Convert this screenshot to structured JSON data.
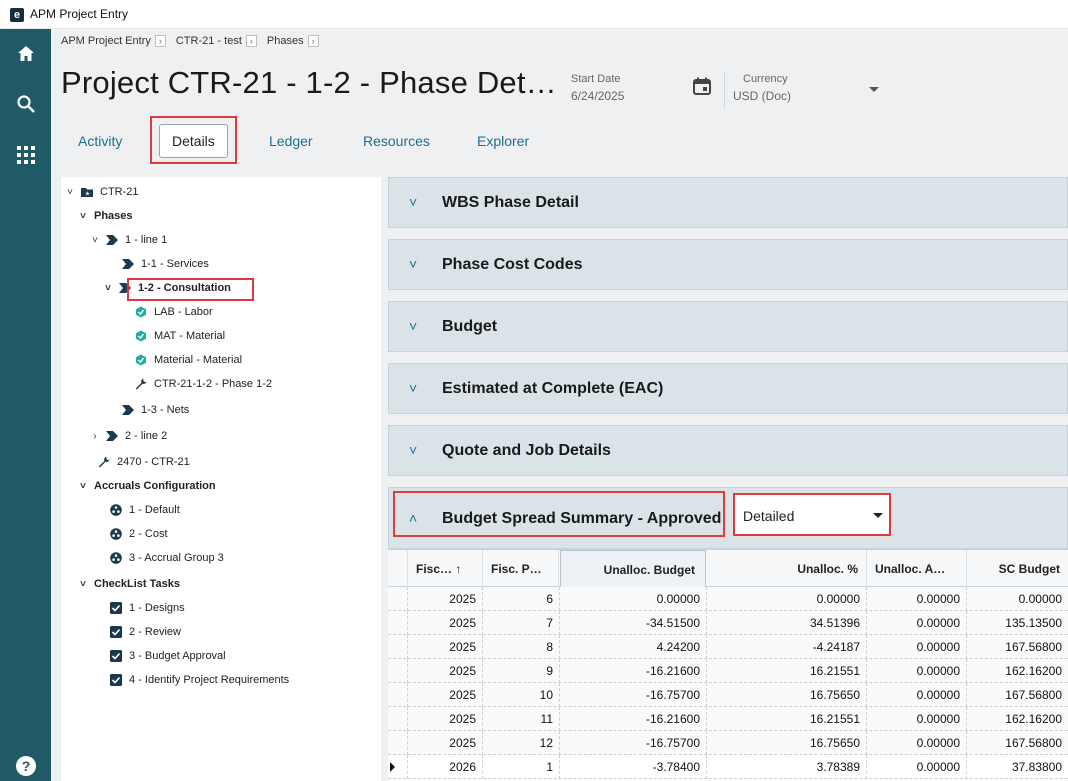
{
  "window": {
    "title": "APM Project Entry"
  },
  "nav": {
    "home": "home-icon",
    "search": "search-icon",
    "apps": "apps-icon",
    "help": "help-icon"
  },
  "breadcrumb": [
    "APM Project Entry",
    "CTR-21 - test",
    "Phases"
  ],
  "header": {
    "title": "Project CTR-21 - 1-2 - Phase Det…",
    "start_date_label": "Start Date",
    "start_date_value": "6/24/2025",
    "currency_label": "Currency",
    "currency_value": "USD (Doc)"
  },
  "tabs": [
    {
      "label": "Activity"
    },
    {
      "label": "Details",
      "active": true
    },
    {
      "label": "Ledger"
    },
    {
      "label": "Resources"
    },
    {
      "label": "Explorer"
    }
  ],
  "tree": [
    {
      "label": "CTR-21",
      "caret": "˅",
      "icon": "project-icon"
    },
    {
      "label": "Phases",
      "caret": "˅"
    },
    {
      "label": "1 - line 1",
      "caret": "˅",
      "icon": "phase-icon"
    },
    {
      "label": "1-1 - Services",
      "icon": "phase-icon"
    },
    {
      "label": "1-2 - Consultation",
      "caret": "˅",
      "icon": "phase-icon",
      "selected": true
    },
    {
      "label": "LAB - Labor",
      "icon": "cost-code-icon"
    },
    {
      "label": "MAT - Material",
      "icon": "cost-code-icon"
    },
    {
      "label": "Material - Material",
      "icon": "cost-code-icon"
    },
    {
      "label": "CTR-21-1-2 - Phase 1-2",
      "icon": "wrench-icon"
    },
    {
      "label": "1-3 - Nets",
      "icon": "phase-icon"
    },
    {
      "label": "2 - line 2",
      "caret": "›",
      "icon": "phase-icon"
    },
    {
      "label": "2470 - CTR-21",
      "icon": "wrench-icon"
    },
    {
      "label": "Accruals Configuration",
      "caret": "˅"
    },
    {
      "label": "1 - Default",
      "icon": "accrual-icon"
    },
    {
      "label": "2 - Cost",
      "icon": "accrual-icon"
    },
    {
      "label": "3 - Accrual Group 3",
      "icon": "accrual-icon"
    },
    {
      "label": "CheckList Tasks",
      "caret": "˅"
    },
    {
      "label": "1 - Designs",
      "icon": "checkbox-icon"
    },
    {
      "label": "2 - Review",
      "icon": "checkbox-icon"
    },
    {
      "label": "3 - Budget Approval",
      "icon": "checkbox-icon"
    },
    {
      "label": "4 - Identify Project Requirements",
      "icon": "checkbox-icon"
    }
  ],
  "panels": [
    {
      "title": "WBS Phase Detail",
      "chevron": "˅"
    },
    {
      "title": "Phase Cost Codes",
      "chevron": "˅"
    },
    {
      "title": "Budget",
      "chevron": "˅"
    },
    {
      "title": "Estimated at Complete (EAC)",
      "chevron": "˅"
    },
    {
      "title": "Quote and Job Details",
      "chevron": "˅"
    },
    {
      "title": "Budget Spread Summary - Approved",
      "chevron": "˄"
    }
  ],
  "spread_view": {
    "selected": "Detailed"
  },
  "grid": {
    "columns": [
      "Fisc… ↑",
      "Fisc. P…",
      "Unalloc. Budget",
      "Unalloc. %",
      "Unalloc. A…",
      "SC Budget"
    ],
    "rows": [
      [
        "2025",
        "6",
        "0.00000",
        "0.00000",
        "0.00000",
        "0.00000"
      ],
      [
        "2025",
        "7",
        "-34.51500",
        "34.51396",
        "0.00000",
        "135.13500"
      ],
      [
        "2025",
        "8",
        "4.24200",
        "-4.24187",
        "0.00000",
        "167.56800"
      ],
      [
        "2025",
        "9",
        "-16.21600",
        "16.21551",
        "0.00000",
        "162.16200"
      ],
      [
        "2025",
        "10",
        "-16.75700",
        "16.75650",
        "0.00000",
        "167.56800"
      ],
      [
        "2025",
        "11",
        "-16.21600",
        "16.21551",
        "0.00000",
        "162.16200"
      ],
      [
        "2025",
        "12",
        "-16.75700",
        "16.75650",
        "0.00000",
        "167.56800"
      ],
      [
        "2026",
        "1",
        "-3.78400",
        "3.78389",
        "0.00000",
        "37.83800"
      ]
    ]
  },
  "colors": {
    "sidebar": "#1f5a66",
    "accent": "#1f6e8c",
    "highlight": "#e0393e",
    "panel": "#d9e3e8"
  }
}
